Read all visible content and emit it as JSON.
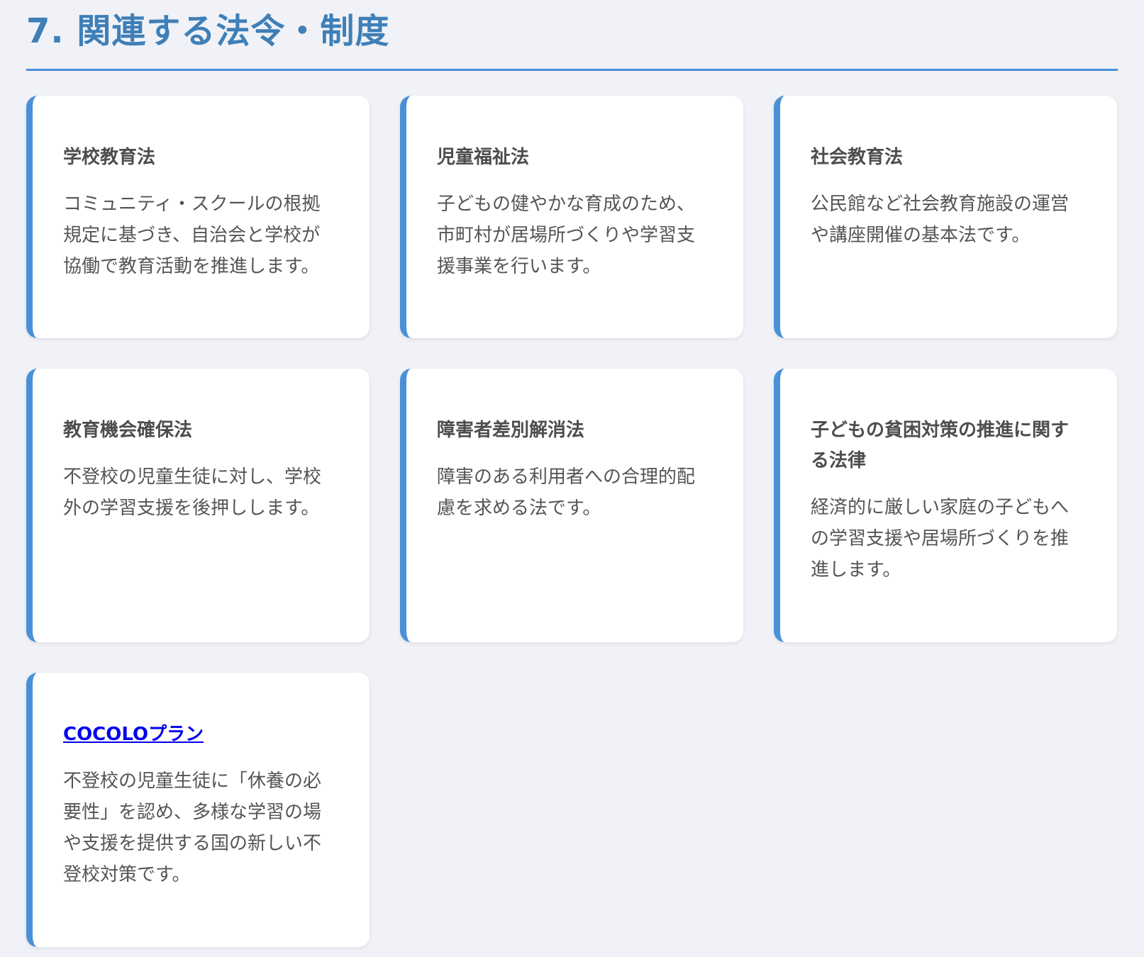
{
  "section": {
    "title": "7. 関連する法令・制度"
  },
  "cards": [
    {
      "title": "学校教育法",
      "description": "コミュニティ・スクールの根拠規定に基づき、自治会と学校が協働で教育活動を推進します。"
    },
    {
      "title": "児童福祉法",
      "description": "子どもの健やかな育成のため、市町村が居場所づくりや学習支援事業を行います。"
    },
    {
      "title": "社会教育法",
      "description": "公民館など社会教育施設の運営や講座開催の基本法です。"
    },
    {
      "title": "教育機会確保法",
      "description": "不登校の児童生徒に対し、学校外の学習支援を後押しします。"
    },
    {
      "title": "障害者差別解消法",
      "description": "障害のある利用者への合理的配慮を求める法です。"
    },
    {
      "title": "子どもの貧困対策の推進に関する法律",
      "description": "経済的に厳しい家庭の子どもへの学習支援や居場所づくりを推進します。"
    },
    {
      "title": "COCOLOプラン",
      "description": "不登校の児童生徒に「休養の必要性」を認め、多様な学習の場や支援を提供する国の新しい不登校対策です。"
    }
  ],
  "colors": {
    "background": "#f0f2f7",
    "accent": "#4a90d9",
    "title": "#3f7fb7",
    "link": "#0000ee"
  }
}
